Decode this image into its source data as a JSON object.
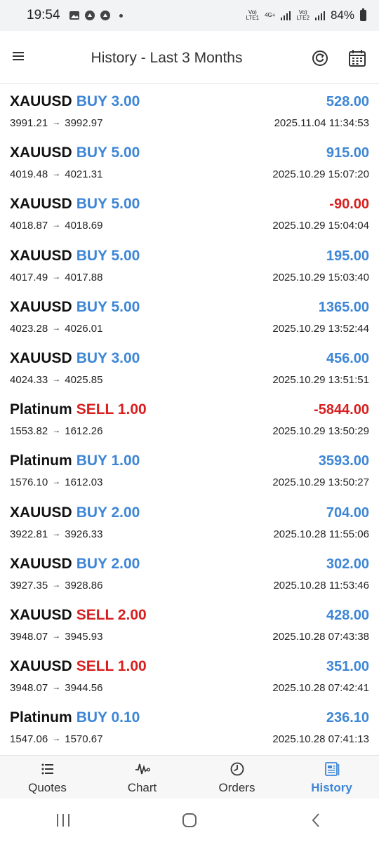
{
  "status_bar": {
    "time": "19:54",
    "net1_top": "Vo)",
    "net1_bottom": "LTE1",
    "net_type": "4G+",
    "net2_top": "Vo)",
    "net2_bottom": "LTE2",
    "battery": "84%"
  },
  "header": {
    "title": "History - Last 3 Months",
    "menu_icon": "menu-icon",
    "refresh_icon": "refresh-icon",
    "calendar_icon": "calendar-icon"
  },
  "trades": [
    {
      "symbol": "XAUUSD",
      "action": "BUY 3.00",
      "side": "buy",
      "profit": "528.00",
      "sign": "pos",
      "open": "3991.21",
      "close": "3992.97",
      "time": "2025.11.04 11:34:53"
    },
    {
      "symbol": "XAUUSD",
      "action": "BUY 5.00",
      "side": "buy",
      "profit": "915.00",
      "sign": "pos",
      "open": "4019.48",
      "close": "4021.31",
      "time": "2025.10.29 15:07:20"
    },
    {
      "symbol": "XAUUSD",
      "action": "BUY 5.00",
      "side": "buy",
      "profit": "-90.00",
      "sign": "neg",
      "open": "4018.87",
      "close": "4018.69",
      "time": "2025.10.29 15:04:04"
    },
    {
      "symbol": "XAUUSD",
      "action": "BUY 5.00",
      "side": "buy",
      "profit": "195.00",
      "sign": "pos",
      "open": "4017.49",
      "close": "4017.88",
      "time": "2025.10.29 15:03:40"
    },
    {
      "symbol": "XAUUSD",
      "action": "BUY 5.00",
      "side": "buy",
      "profit": "1365.00",
      "sign": "pos",
      "open": "4023.28",
      "close": "4026.01",
      "time": "2025.10.29 13:52:44"
    },
    {
      "symbol": "XAUUSD",
      "action": "BUY 3.00",
      "side": "buy",
      "profit": "456.00",
      "sign": "pos",
      "open": "4024.33",
      "close": "4025.85",
      "time": "2025.10.29 13:51:51"
    },
    {
      "symbol": "Platinum",
      "action": "SELL 1.00",
      "side": "sell",
      "profit": "-5844.00",
      "sign": "neg",
      "open": "1553.82",
      "close": "1612.26",
      "time": "2025.10.29 13:50:29"
    },
    {
      "symbol": "Platinum",
      "action": "BUY 1.00",
      "side": "buy",
      "profit": "3593.00",
      "sign": "pos",
      "open": "1576.10",
      "close": "1612.03",
      "time": "2025.10.29 13:50:27"
    },
    {
      "symbol": "XAUUSD",
      "action": "BUY 2.00",
      "side": "buy",
      "profit": "704.00",
      "sign": "pos",
      "open": "3922.81",
      "close": "3926.33",
      "time": "2025.10.28 11:55:06"
    },
    {
      "symbol": "XAUUSD",
      "action": "BUY 2.00",
      "side": "buy",
      "profit": "302.00",
      "sign": "pos",
      "open": "3927.35",
      "close": "3928.86",
      "time": "2025.10.28 11:53:46"
    },
    {
      "symbol": "XAUUSD",
      "action": "SELL 2.00",
      "side": "sell",
      "profit": "428.00",
      "sign": "pos",
      "open": "3948.07",
      "close": "3945.93",
      "time": "2025.10.28 07:43:38"
    },
    {
      "symbol": "XAUUSD",
      "action": "SELL 1.00",
      "side": "sell",
      "profit": "351.00",
      "sign": "pos",
      "open": "3948.07",
      "close": "3944.56",
      "time": "2025.10.28 07:42:41"
    },
    {
      "symbol": "Platinum",
      "action": "BUY 0.10",
      "side": "buy",
      "profit": "236.10",
      "sign": "pos",
      "open": "1547.06",
      "close": "1570.67",
      "time": "2025.10.28 07:41:13"
    }
  ],
  "arrow": "→",
  "bottom_nav": [
    {
      "label": "Quotes",
      "icon": "list-icon",
      "active": false
    },
    {
      "label": "Chart",
      "icon": "chart-icon",
      "active": false
    },
    {
      "label": "Orders",
      "icon": "clock-icon",
      "active": false
    },
    {
      "label": "History",
      "icon": "history-icon",
      "active": true
    }
  ],
  "colors": {
    "buy": "#3d86d6",
    "sell": "#d81e1e",
    "active_tab": "#3d86d6"
  }
}
